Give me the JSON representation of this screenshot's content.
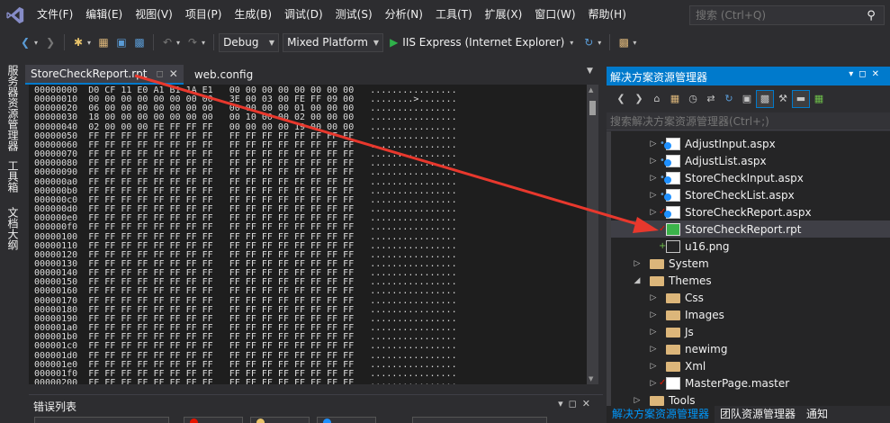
{
  "menu": {
    "items": [
      "文件(F)",
      "编辑(E)",
      "视图(V)",
      "项目(P)",
      "生成(B)",
      "调试(D)",
      "测试(S)",
      "分析(N)",
      "工具(T)",
      "扩展(X)",
      "窗口(W)",
      "帮助(H)"
    ],
    "search_placeholder": "搜索 (Ctrl+Q)"
  },
  "toolbar": {
    "config": "Debug",
    "platform": "Mixed Platform",
    "run_label": "IIS Express (Internet Explorer)"
  },
  "left_strip": {
    "tabs": [
      "服务器资源管理器",
      "工具箱",
      "文档大纲"
    ]
  },
  "editor": {
    "tabs": [
      {
        "label": "StoreCheckReport.rpt",
        "active": true
      },
      {
        "label": "web.config",
        "active": false
      }
    ],
    "hex_lines": [
      "00000000  D0 CF 11 E0 A1 B1 1A E1   00 00 00 00 00 00 00 00   ................",
      "00000010  00 00 00 00 00 00 00 00   3E 00 03 00 FE FF 09 00   ........>.......",
      "00000020  06 00 00 00 00 00 00 00   00 00 00 00 01 00 00 00   ................",
      "00000030  18 00 00 00 00 00 00 00   00 10 00 00 02 00 00 00   ................",
      "00000040  02 00 00 00 FE FF FF FF   00 00 00 00 19 00 00 00   ................",
      "00000050  FF FF FF FF FF FF FF FF   FF FF FF FF FF FF FF FF   ................",
      "00000060  FF FF FF FF FF FF FF FF   FF FF FF FF FF FF FF FF   ................",
      "00000070  FF FF FF FF FF FF FF FF   FF FF FF FF FF FF FF FF   ................",
      "00000080  FF FF FF FF FF FF FF FF   FF FF FF FF FF FF FF FF   ................",
      "00000090  FF FF FF FF FF FF FF FF   FF FF FF FF FF FF FF FF   ................",
      "000000a0  FF FF FF FF FF FF FF FF   FF FF FF FF FF FF FF FF   ................",
      "000000b0  FF FF FF FF FF FF FF FF   FF FF FF FF FF FF FF FF   ................",
      "000000c0  FF FF FF FF FF FF FF FF   FF FF FF FF FF FF FF FF   ................",
      "000000d0  FF FF FF FF FF FF FF FF   FF FF FF FF FF FF FF FF   ................",
      "000000e0  FF FF FF FF FF FF FF FF   FF FF FF FF FF FF FF FF   ................",
      "000000f0  FF FF FF FF FF FF FF FF   FF FF FF FF FF FF FF FF   ................",
      "00000100  FF FF FF FF FF FF FF FF   FF FF FF FF FF FF FF FF   ................",
      "00000110  FF FF FF FF FF FF FF FF   FF FF FF FF FF FF FF FF   ................",
      "00000120  FF FF FF FF FF FF FF FF   FF FF FF FF FF FF FF FF   ................",
      "00000130  FF FF FF FF FF FF FF FF   FF FF FF FF FF FF FF FF   ................",
      "00000140  FF FF FF FF FF FF FF FF   FF FF FF FF FF FF FF FF   ................",
      "00000150  FF FF FF FF FF FF FF FF   FF FF FF FF FF FF FF FF   ................",
      "00000160  FF FF FF FF FF FF FF FF   FF FF FF FF FF FF FF FF   ................",
      "00000170  FF FF FF FF FF FF FF FF   FF FF FF FF FF FF FF FF   ................",
      "00000180  FF FF FF FF FF FF FF FF   FF FF FF FF FF FF FF FF   ................",
      "00000190  FF FF FF FF FF FF FF FF   FF FF FF FF FF FF FF FF   ................",
      "000001a0  FF FF FF FF FF FF FF FF   FF FF FF FF FF FF FF FF   ................",
      "000001b0  FF FF FF FF FF FF FF FF   FF FF FF FF FF FF FF FF   ................",
      "000001c0  FF FF FF FF FF FF FF FF   FF FF FF FF FF FF FF FF   ................",
      "000001d0  FF FF FF FF FF FF FF FF   FF FF FF FF FF FF FF FF   ................",
      "000001e0  FF FF FF FF FF FF FF FF   FF FF FF FF FF FF FF FF   ................",
      "000001f0  FF FF FF FF FF FF FF FF   FF FF FF FF FF FF FF FF   ................",
      "00000200  FF FF FF FF FF FF FF FF   FF FF FF FF FF FF FF FF   ................"
    ]
  },
  "error_panel": {
    "title": "错误列表"
  },
  "solution_explorer": {
    "title": "解决方案资源管理器",
    "search_placeholder": "搜索解决方案资源管理器(Ctrl+;)",
    "items": [
      {
        "label": "AdjustInput.aspx",
        "level": 3,
        "arrow": "right",
        "mark": "lock",
        "icon": "aspx"
      },
      {
        "label": "AdjustList.aspx",
        "level": 3,
        "arrow": "right",
        "mark": "lock",
        "icon": "aspx"
      },
      {
        "label": "StoreCheckInput.aspx",
        "level": 3,
        "arrow": "right",
        "mark": "lock",
        "icon": "aspx"
      },
      {
        "label": "StoreCheckList.aspx",
        "level": 3,
        "arrow": "right",
        "mark": "lock",
        "icon": "aspx"
      },
      {
        "label": "StoreCheckReport.aspx",
        "level": 3,
        "arrow": "right",
        "mark": "check",
        "icon": "aspx"
      },
      {
        "label": "StoreCheckReport.rpt",
        "level": 3,
        "arrow": "",
        "mark": "check",
        "icon": "rpt",
        "selected": true
      },
      {
        "label": "u16.png",
        "level": 3,
        "arrow": "",
        "mark": "plus",
        "icon": "png"
      },
      {
        "label": "System",
        "level": 2,
        "arrow": "right",
        "mark": "",
        "icon": "folder"
      },
      {
        "label": "Themes",
        "level": 2,
        "arrow": "down",
        "mark": "",
        "icon": "folder"
      },
      {
        "label": "Css",
        "level": 3,
        "arrow": "right",
        "mark": "",
        "icon": "folder"
      },
      {
        "label": "Images",
        "level": 3,
        "arrow": "right",
        "mark": "",
        "icon": "folder"
      },
      {
        "label": "Js",
        "level": 3,
        "arrow": "right",
        "mark": "",
        "icon": "folder"
      },
      {
        "label": "newimg",
        "level": 3,
        "arrow": "right",
        "mark": "",
        "icon": "folder"
      },
      {
        "label": "Xml",
        "level": 3,
        "arrow": "right",
        "mark": "",
        "icon": "folder"
      },
      {
        "label": "MasterPage.master",
        "level": 3,
        "arrow": "right",
        "mark": "check",
        "icon": "master"
      },
      {
        "label": "Tools",
        "level": 2,
        "arrow": "right",
        "mark": "",
        "icon": "folder"
      }
    ],
    "bottom_tabs": [
      "解决方案资源管理器",
      "团队资源管理器",
      "通知"
    ]
  },
  "colors": {
    "accent": "#007acc",
    "annotation_arrow": "#e8382d"
  }
}
